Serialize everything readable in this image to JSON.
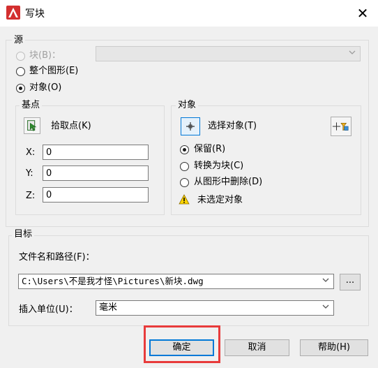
{
  "window": {
    "title": "写块",
    "close_glyph": "✕"
  },
  "source": {
    "group_label": "源",
    "block_label": "块(B)：",
    "block_dropdown_value": "",
    "entire_drawing_label": "整个图形(E)",
    "objects_label": "对象(O)",
    "selected": "objects"
  },
  "base_point": {
    "group_label": "基点",
    "pick_point_label": "拾取点(K)",
    "x_label": "X:",
    "x_value": "0",
    "y_label": "Y:",
    "y_value": "0",
    "z_label": "Z:",
    "z_value": "0"
  },
  "objects": {
    "group_label": "对象",
    "select_objects_label": "选择对象(T)",
    "retain_label": "保留(R)",
    "convert_label": "转换为块(C)",
    "delete_label": "从图形中删除(D)",
    "selected": "retain",
    "warning_text": "未选定对象"
  },
  "destination": {
    "group_label": "目标",
    "filename_label": "文件名和路径(F)：",
    "filename_value": "C:\\Users\\不是我才怪\\Pictures\\新块.dwg",
    "browse_label": "...",
    "units_label": "插入单位(U)：",
    "units_value": "毫米"
  },
  "buttons": {
    "ok": "确定",
    "cancel": "取消",
    "help": "帮助(H)"
  },
  "colors": {
    "accent": "#0078d7",
    "highlight": "#e83b3b",
    "warning": "#ffd400",
    "logo": "#d32f2f"
  }
}
